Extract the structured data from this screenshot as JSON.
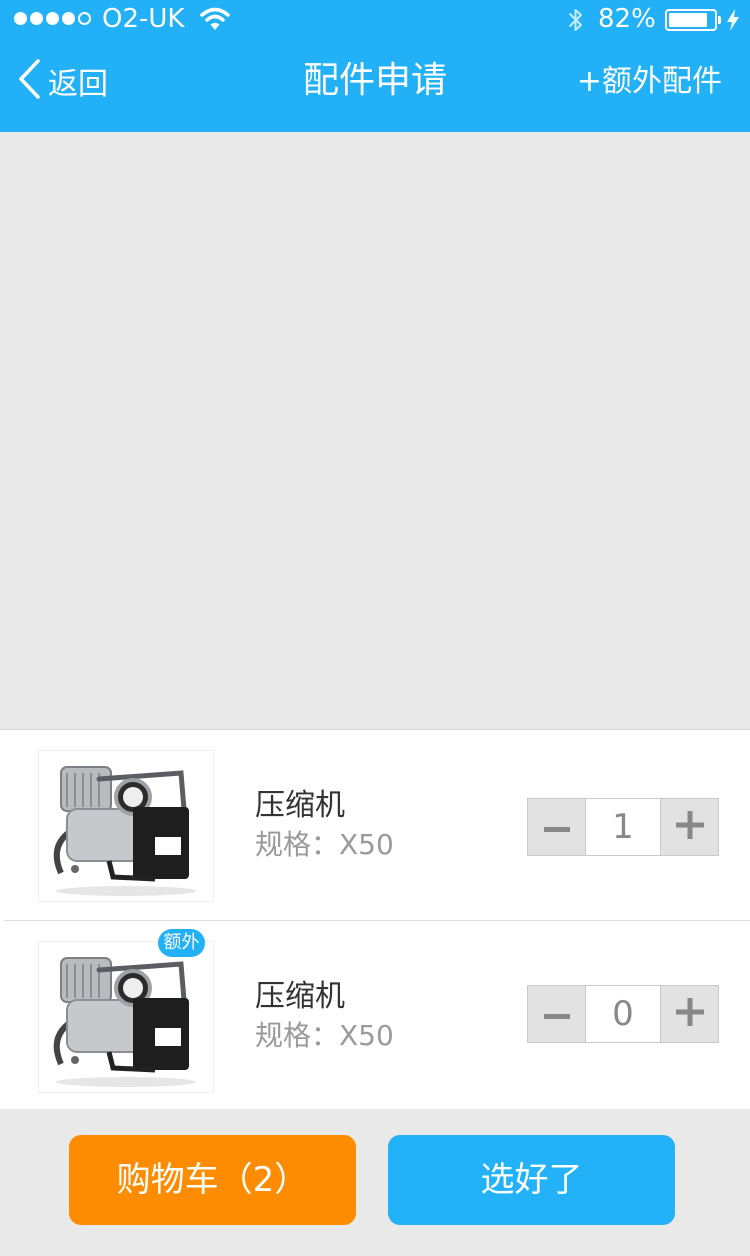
{
  "status_bar": {
    "carrier": "O2-UK",
    "battery_percent": "82%",
    "signal_bars_filled": 4,
    "signal_bars_total": 5
  },
  "nav": {
    "back_label": "返回",
    "title": "配件申请",
    "extra_label": "+额外配件"
  },
  "items": [
    {
      "name": "压缩机",
      "spec": "规格：X50",
      "quantity": "1",
      "badge": ""
    },
    {
      "name": "压缩机",
      "spec": "规格：X50",
      "quantity": "0",
      "badge": "额外"
    }
  ],
  "footer": {
    "cart_label": "购物车（2）",
    "done_label": "选好了"
  },
  "colors": {
    "brand": "#22b1f7",
    "cart": "#fd8c03",
    "background": "#e9e9e9"
  },
  "icons": {
    "back": "chevron-left-icon",
    "minus": "minus-icon",
    "plus": "plus-icon",
    "wifi": "wifi-icon",
    "bluetooth": "bluetooth-icon",
    "battery": "battery-icon",
    "charging": "bolt-icon"
  }
}
